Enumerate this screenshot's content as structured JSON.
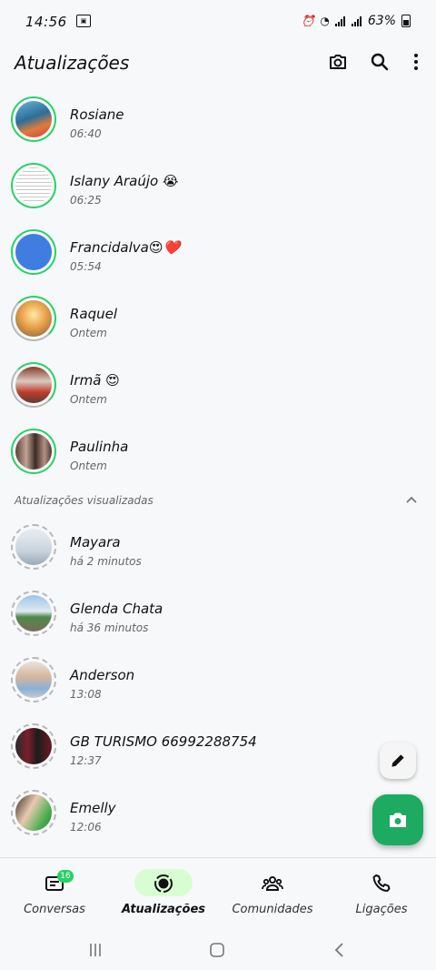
{
  "status": {
    "time": "14:56",
    "battery": "63%"
  },
  "appbar": {
    "title": "Atualizações"
  },
  "updates": [
    {
      "name": "Rosiane",
      "time": "06:40"
    },
    {
      "name": "Islany Araújo 😭",
      "time": "06:25"
    },
    {
      "name": "Francidalva😍❤️",
      "time": "05:54"
    },
    {
      "name": "Raquel",
      "time": "Ontem"
    },
    {
      "name": "Irmã 😍",
      "time": "Ontem"
    },
    {
      "name": "Paulinha",
      "time": "Ontem"
    }
  ],
  "viewed_section": {
    "label": "Atualizações visualizadas"
  },
  "viewed": [
    {
      "name": "Mayara",
      "time": "há 2 minutos"
    },
    {
      "name": "Glenda Chata",
      "time": "há 36 minutos"
    },
    {
      "name": "Anderson",
      "time": "13:08"
    },
    {
      "name": "GB TURISMO 66992288754",
      "time": "12:37"
    },
    {
      "name": "Emelly",
      "time": "12:06"
    }
  ],
  "nav": [
    {
      "label": "Conversas",
      "badge": "16"
    },
    {
      "label": "Atualizações"
    },
    {
      "label": "Comunidades"
    },
    {
      "label": "Ligações"
    }
  ],
  "colors": {
    "accent": "#1daa61",
    "ring": "#25d366",
    "pill": "#d9fdd3"
  }
}
